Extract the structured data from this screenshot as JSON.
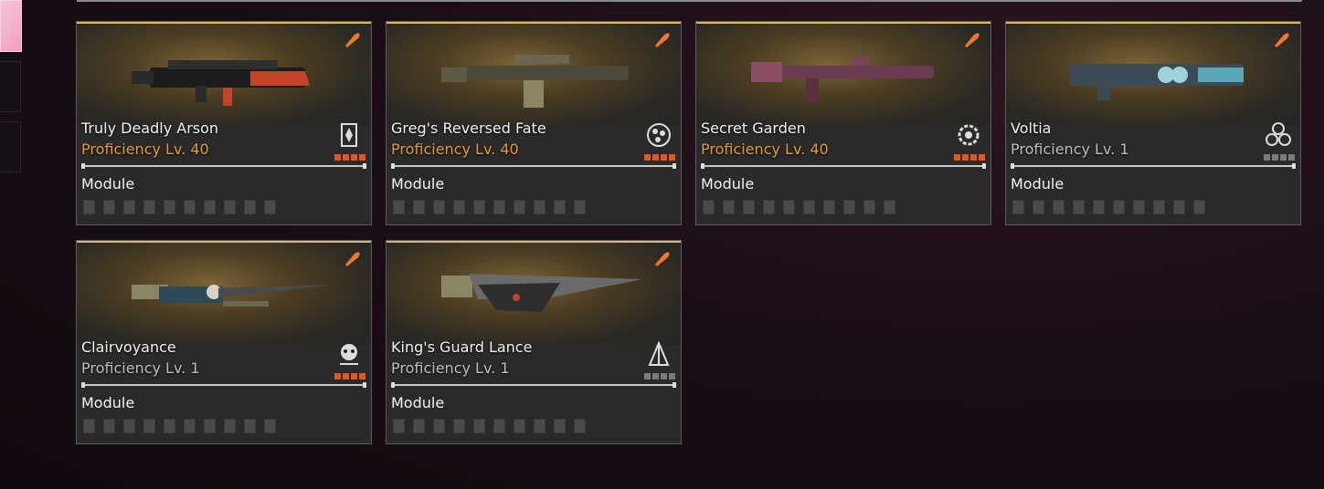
{
  "module_label": "Module",
  "cards": [
    {
      "name": "Truly Deadly Arson",
      "proficiency": "Proficiency Lv. 40",
      "level": "high",
      "element_icon": "card-emblem-icon",
      "stars": "orange",
      "module_slots": 10
    },
    {
      "name": "Greg's Reversed Fate",
      "proficiency": "Proficiency Lv. 40",
      "level": "high",
      "element_icon": "orbs-emblem-icon",
      "stars": "orange",
      "module_slots": 10
    },
    {
      "name": "Secret Garden",
      "proficiency": "Proficiency Lv. 40",
      "level": "high",
      "element_icon": "gear-emblem-icon",
      "stars": "orange",
      "module_slots": 10
    },
    {
      "name": "Voltia",
      "proficiency": "Proficiency Lv. 1",
      "level": "low",
      "element_icon": "triple-circle-icon",
      "stars": "gray",
      "module_slots": 10
    },
    {
      "name": "Clairvoyance",
      "proficiency": "Proficiency Lv. 1",
      "level": "low",
      "element_icon": "skull-emblem-icon",
      "stars": "orange",
      "module_slots": 10
    },
    {
      "name": "King's Guard Lance",
      "proficiency": "Proficiency Lv. 1",
      "level": "low",
      "element_icon": "spire-emblem-icon",
      "stars": "gray",
      "module_slots": 10
    }
  ],
  "colors": {
    "accent_orange": "#e39c3c",
    "star_orange": "#e0581e",
    "ammo_icon": "#f0762b"
  }
}
